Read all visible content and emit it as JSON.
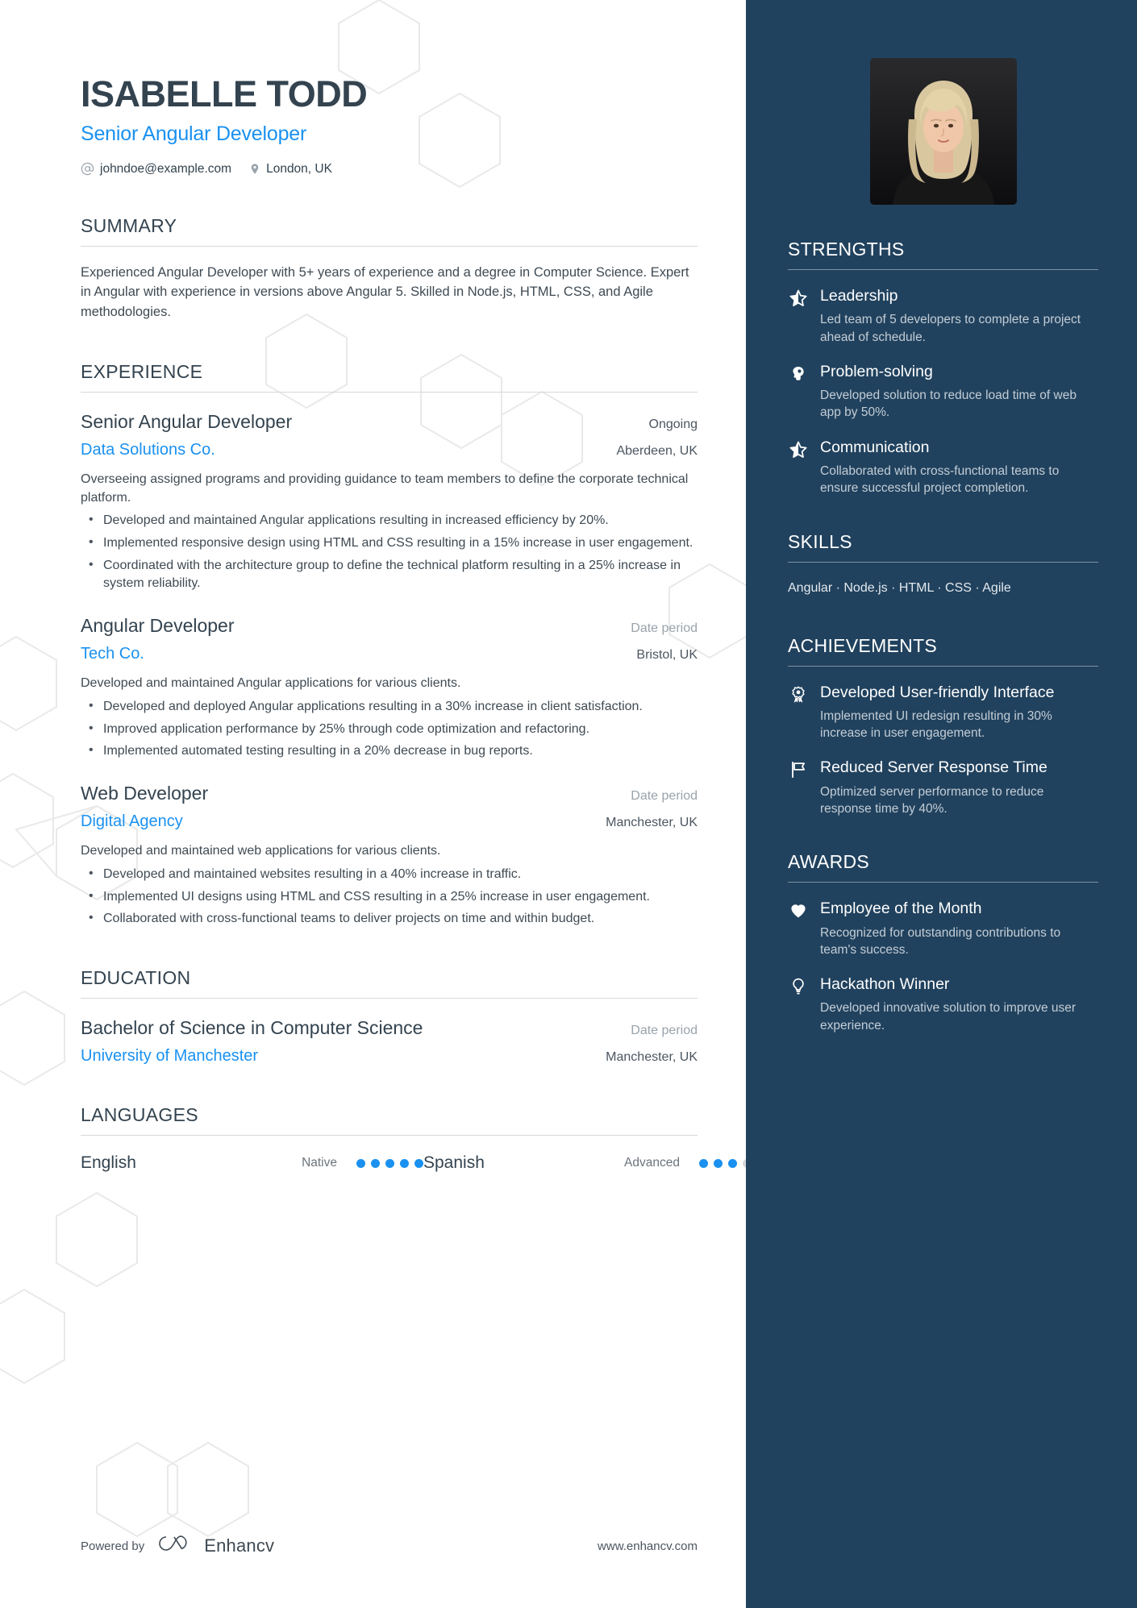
{
  "colors": {
    "accent_blue": "#1a91f0",
    "sidebar_bg": "#21425e",
    "heading_dark": "#33434f",
    "muted_gray": "#9aa3ab"
  },
  "header": {
    "name": "ISABELLE TODD",
    "headline": "Senior Angular Developer",
    "email": "johndoe@example.com",
    "location": "London, UK",
    "email_icon": "at-sign-icon",
    "location_icon": "map-pin-icon"
  },
  "summary": {
    "title": "SUMMARY",
    "text": "Experienced Angular Developer with 5+ years of experience and a degree in Computer Science. Expert in Angular with experience in versions above Angular 5. Skilled in Node.js, HTML, CSS, and Agile methodologies."
  },
  "experience": {
    "title": "EXPERIENCE",
    "entries": [
      {
        "role": "Senior Angular Developer",
        "date": "Ongoing",
        "company": "Data Solutions Co.",
        "location": "Aberdeen, UK",
        "description": "Overseeing assigned programs and providing guidance to team members to define the corporate technical platform.",
        "bullets": [
          "Developed and maintained Angular applications resulting in increased efficiency by 20%.",
          "Implemented responsive design using HTML and CSS resulting in a 15% increase in user engagement.",
          "Coordinated with the architecture group to define the technical platform resulting in a 25% increase in system reliability."
        ]
      },
      {
        "role": "Angular Developer",
        "date": "Date period",
        "company": "Tech Co.",
        "location": "Bristol, UK",
        "description": "Developed and maintained Angular applications for various clients.",
        "bullets": [
          "Developed and deployed Angular applications resulting in a 30% increase in client satisfaction.",
          "Improved application performance by 25% through code optimization and refactoring.",
          "Implemented automated testing resulting in a 20% decrease in bug reports."
        ]
      },
      {
        "role": "Web Developer",
        "date": "Date period",
        "company": "Digital Agency",
        "location": "Manchester, UK",
        "description": "Developed and maintained web applications for various clients.",
        "bullets": [
          "Developed and maintained websites resulting in a 40% increase in traffic.",
          "Implemented UI designs using HTML and CSS resulting in a 25% increase in user engagement.",
          "Collaborated with cross-functional teams to deliver projects on time and within budget."
        ]
      }
    ]
  },
  "education": {
    "title": "EDUCATION",
    "entries": [
      {
        "degree": "Bachelor of Science in Computer Science",
        "date": "Date period",
        "school": "University of Manchester",
        "location": "Manchester, UK"
      }
    ]
  },
  "languages": {
    "title": "LANGUAGES",
    "items": [
      {
        "name": "English",
        "level": "Native",
        "rating": 5,
        "max": 5
      },
      {
        "name": "Spanish",
        "level": "Advanced",
        "rating": 3,
        "max": 5
      }
    ]
  },
  "footer": {
    "powered_by": "Powered by",
    "brand": "Enhancv",
    "brand_icon": "enhancv-logo-icon",
    "website": "www.enhancv.com"
  },
  "sidebar": {
    "photo": {
      "alt": "profile-photo"
    },
    "strengths": {
      "title": "STRENGTHS",
      "items": [
        {
          "icon": "star-half-icon",
          "title": "Leadership",
          "desc": "Led team of 5 developers to complete a project ahead of schedule."
        },
        {
          "icon": "head-brain-icon",
          "title": "Problem-solving",
          "desc": "Developed solution to reduce load time of web app by 50%."
        },
        {
          "icon": "star-half-icon",
          "title": "Communication",
          "desc": "Collaborated with cross-functional teams to ensure successful project completion."
        }
      ]
    },
    "skills": {
      "title": "SKILLS",
      "items": [
        "Angular",
        "Node.js",
        "HTML",
        "CSS",
        "Agile"
      ],
      "separator": " · "
    },
    "achievements": {
      "title": "ACHIEVEMENTS",
      "items": [
        {
          "icon": "award-medal-icon",
          "title": "Developed User-friendly Interface",
          "desc": "Implemented UI redesign resulting in 30% increase in user engagement."
        },
        {
          "icon": "flag-icon",
          "title": "Reduced Server Response Time",
          "desc": "Optimized server performance to reduce response time by 40%."
        }
      ]
    },
    "awards": {
      "title": "AWARDS",
      "items": [
        {
          "icon": "heart-icon",
          "title": "Employee of the Month",
          "desc": "Recognized for outstanding contributions to team's success."
        },
        {
          "icon": "lightbulb-icon",
          "title": "Hackathon Winner",
          "desc": "Developed innovative solution to improve user experience."
        }
      ]
    }
  }
}
